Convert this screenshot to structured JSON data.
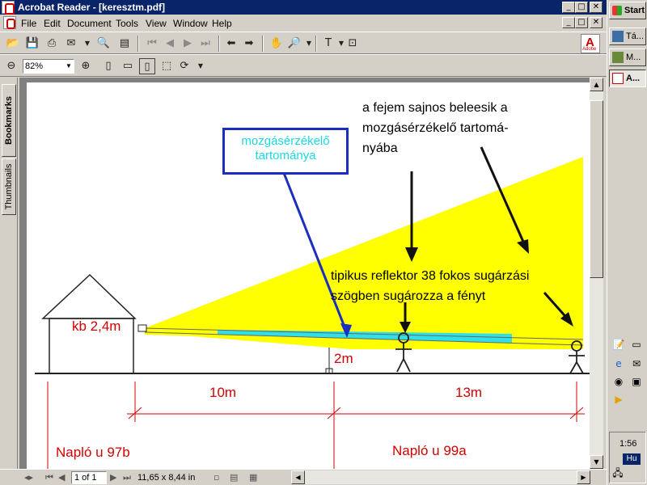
{
  "window": {
    "title": "Acrobat Reader - [keresztm.pdf]",
    "controls": [
      "_",
      "□",
      "✕"
    ],
    "doc_controls": [
      "_",
      "□",
      "✕"
    ]
  },
  "menu": [
    {
      "label": "File"
    },
    {
      "label": "Edit"
    },
    {
      "label": "Document"
    },
    {
      "label": "Tools"
    },
    {
      "label": "View"
    },
    {
      "label": "Window"
    },
    {
      "label": "Help"
    }
  ],
  "toolbar": {
    "zoom_value": "82%",
    "zoom_arrow": "▼",
    "adobe_logo": "A",
    "adobe_text": "Adobe"
  },
  "panel_tabs": {
    "bookmarks": "Bookmarks",
    "thumbnails": "Thumbnails"
  },
  "document": {
    "annotations": {
      "callout": [
        "mozgásérzékelő",
        "tartománya"
      ],
      "head_note": [
        "a fejem sajnos beleesik a",
        "mozgásérzékelő tartomá-",
        "nyába"
      ],
      "reflector_note": [
        "tipikus reflektor 38 fokos sugárzási",
        "szögben sugározza a fényt"
      ],
      "height_label": "kb 2,4m",
      "person_height": "2m",
      "dist_left": "10m",
      "dist_right": "13m",
      "address_left": "Napló u 97b",
      "address_right": "Napló u 99a"
    },
    "colors": {
      "light_beam": "#ffff00",
      "callout_border": "#1a2fc0",
      "callout_text": "#19d9e8",
      "red_text": "#d40000"
    }
  },
  "statusbar": {
    "page_display": "1 of 1",
    "page_size": "11,65 x 8,44 in"
  },
  "taskbar": {
    "start": "Start",
    "tasks": [
      "Tá...",
      "M...",
      "A..."
    ],
    "clock": "1:56",
    "language": "Hu"
  }
}
